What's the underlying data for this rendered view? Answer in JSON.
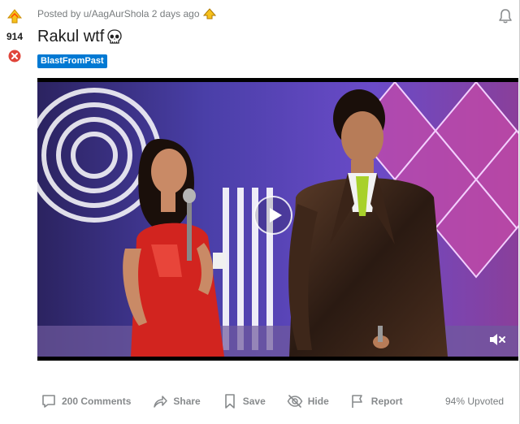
{
  "vote": {
    "score": "914"
  },
  "header": {
    "posted_prefix": "Posted by",
    "author": "u/AagAurShola",
    "time": "2 days ago"
  },
  "post": {
    "title": "Rakul wtf",
    "flair": "BlastFromPast",
    "flair_color": "#0079d3"
  },
  "actions": {
    "comments": "200 Comments",
    "share": "Share",
    "save": "Save",
    "hide": "Hide",
    "report": "Report",
    "upvoted": "94% Upvoted"
  },
  "icons": {
    "upvote": "upvote-arrow-icon",
    "downvote": "downvote-x-icon",
    "award": "award-icon",
    "bell": "bell-icon",
    "skull": "skull-emoji-icon",
    "play": "play-icon",
    "mute": "mute-icon",
    "comment": "comment-icon",
    "share": "share-icon",
    "save": "bookmark-icon",
    "hide": "hide-eye-icon",
    "report": "flag-icon"
  }
}
